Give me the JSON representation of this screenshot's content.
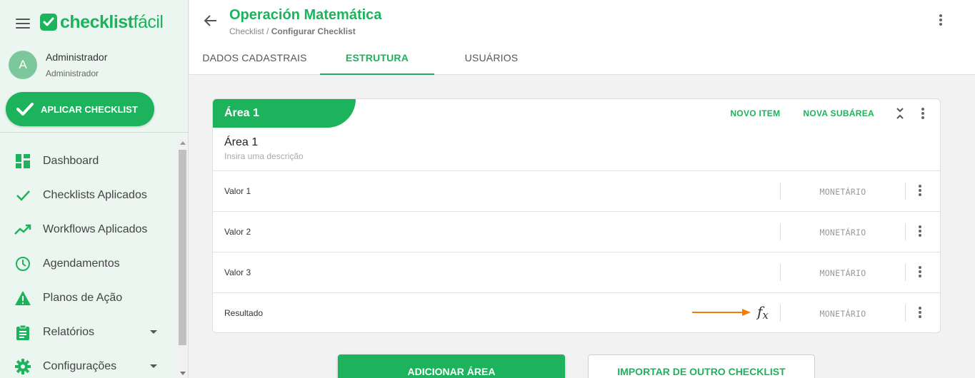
{
  "brand": {
    "name_bold": "checklist",
    "name_light": "fácil",
    "accent_color": "#1cb35c"
  },
  "user": {
    "initial": "A",
    "name": "Administrador",
    "role": "Administrador"
  },
  "sidebar": {
    "apply_button": "APLICAR CHECKLIST",
    "items": [
      {
        "label": "Dashboard",
        "icon": "dashboard-icon"
      },
      {
        "label": "Checklists Aplicados",
        "icon": "check-icon"
      },
      {
        "label": "Workflows Aplicados",
        "icon": "trending-icon"
      },
      {
        "label": "Agendamentos",
        "icon": "clock-icon"
      },
      {
        "label": "Planos de Ação",
        "icon": "warning-icon"
      },
      {
        "label": "Relatórios",
        "icon": "clipboard-icon",
        "expandable": true
      },
      {
        "label": "Configurações",
        "icon": "gear-icon",
        "expandable": true
      }
    ]
  },
  "header": {
    "title": "Operación Matemática",
    "breadcrumb": {
      "parent": "Checklist",
      "separator": " / ",
      "current": "Configurar Checklist"
    },
    "tabs": [
      {
        "label": "DADOS CADASTRAIS",
        "active": false
      },
      {
        "label": "ESTRUTURA",
        "active": true
      },
      {
        "label": "USUÁRIOS",
        "active": false
      }
    ]
  },
  "area": {
    "tag": "Área 1",
    "name": "Área 1",
    "description_placeholder": "Insira uma descrição",
    "actions": {
      "new_item": "NOVO ITEM",
      "new_subarea": "NOVA SUBÁREA"
    },
    "items": [
      {
        "label": "Valor 1",
        "type": "MONETÁRIO",
        "has_formula": false
      },
      {
        "label": "Valor 2",
        "type": "MONETÁRIO",
        "has_formula": false
      },
      {
        "label": "Valor 3",
        "type": "MONETÁRIO",
        "has_formula": false
      },
      {
        "label": "Resultado",
        "type": "MONETÁRIO",
        "has_formula": true
      }
    ]
  },
  "footer_buttons": {
    "add_area": "ADICIONAR ÁREA",
    "import": "IMPORTAR DE OUTRO CHECKLIST"
  },
  "annotation": {
    "arrow_color": "#f57c00"
  }
}
